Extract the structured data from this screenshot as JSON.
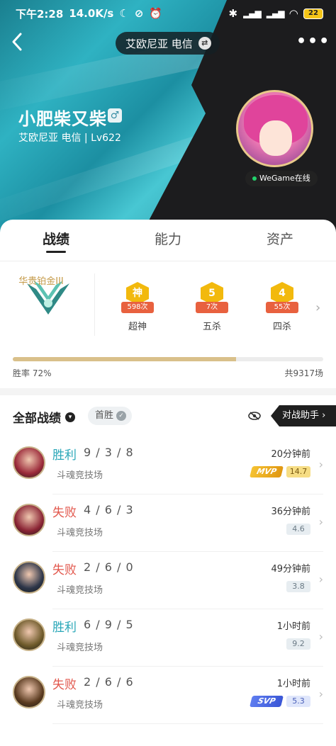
{
  "status_bar": {
    "time": "下午2:28",
    "speed": "14.0K/s",
    "battery": "22"
  },
  "header": {
    "server": "艾欧尼亚 电信",
    "player_name": "小肥柴又柴",
    "gender_symbol": "♂",
    "sub_info": "艾欧尼亚 电信 | Lv622",
    "online_status": "WeGame在线"
  },
  "tabs": [
    {
      "label": "战绩"
    },
    {
      "label": "能力"
    },
    {
      "label": "资产"
    }
  ],
  "rank": {
    "name": "华贵铂金III"
  },
  "honors": [
    {
      "icon_text": "神",
      "count": "598次",
      "label": "超神"
    },
    {
      "icon_text": "5",
      "count": "7次",
      "label": "五杀"
    },
    {
      "icon_text": "4",
      "count": "55次",
      "label": "四杀"
    }
  ],
  "stats": {
    "win_rate_label": "胜率  72%",
    "win_rate": 0.72,
    "total_games": "共9317场"
  },
  "history": {
    "title": "全部战绩",
    "filter": "首胜",
    "assistant": "对战助手 ›"
  },
  "matches": [
    {
      "result": "胜利",
      "outcome": "win",
      "kda": "9 / 3 / 8",
      "mode": "斗魂竞技场",
      "time": "20分钟前",
      "score": "14.7",
      "badge": "MVP",
      "badge_style": "gold",
      "champ_color": "#9b2a3a"
    },
    {
      "result": "失败",
      "outcome": "loss",
      "kda": "4 / 6 / 3",
      "mode": "斗魂竞技场",
      "time": "36分钟前",
      "score": "4.6",
      "badge": "",
      "badge_style": "",
      "champ_color": "#8a2434"
    },
    {
      "result": "失败",
      "outcome": "loss",
      "kda": "2 / 6 / 0",
      "mode": "斗魂竞技场",
      "time": "49分钟前",
      "score": "3.8",
      "badge": "",
      "badge_style": "",
      "champ_color": "#2c3548"
    },
    {
      "result": "胜利",
      "outcome": "win",
      "kda": "6 / 9 / 5",
      "mode": "斗魂竞技场",
      "time": "1小时前",
      "score": "9.2",
      "badge": "",
      "badge_style": "",
      "champ_color": "#6e5a2a"
    },
    {
      "result": "失败",
      "outcome": "loss",
      "kda": "2 / 6 / 6",
      "mode": "斗魂竞技场",
      "time": "1小时前",
      "score": "5.3",
      "badge": "SVP",
      "badge_style": "blue",
      "champ_color": "#5a3a1f"
    }
  ]
}
